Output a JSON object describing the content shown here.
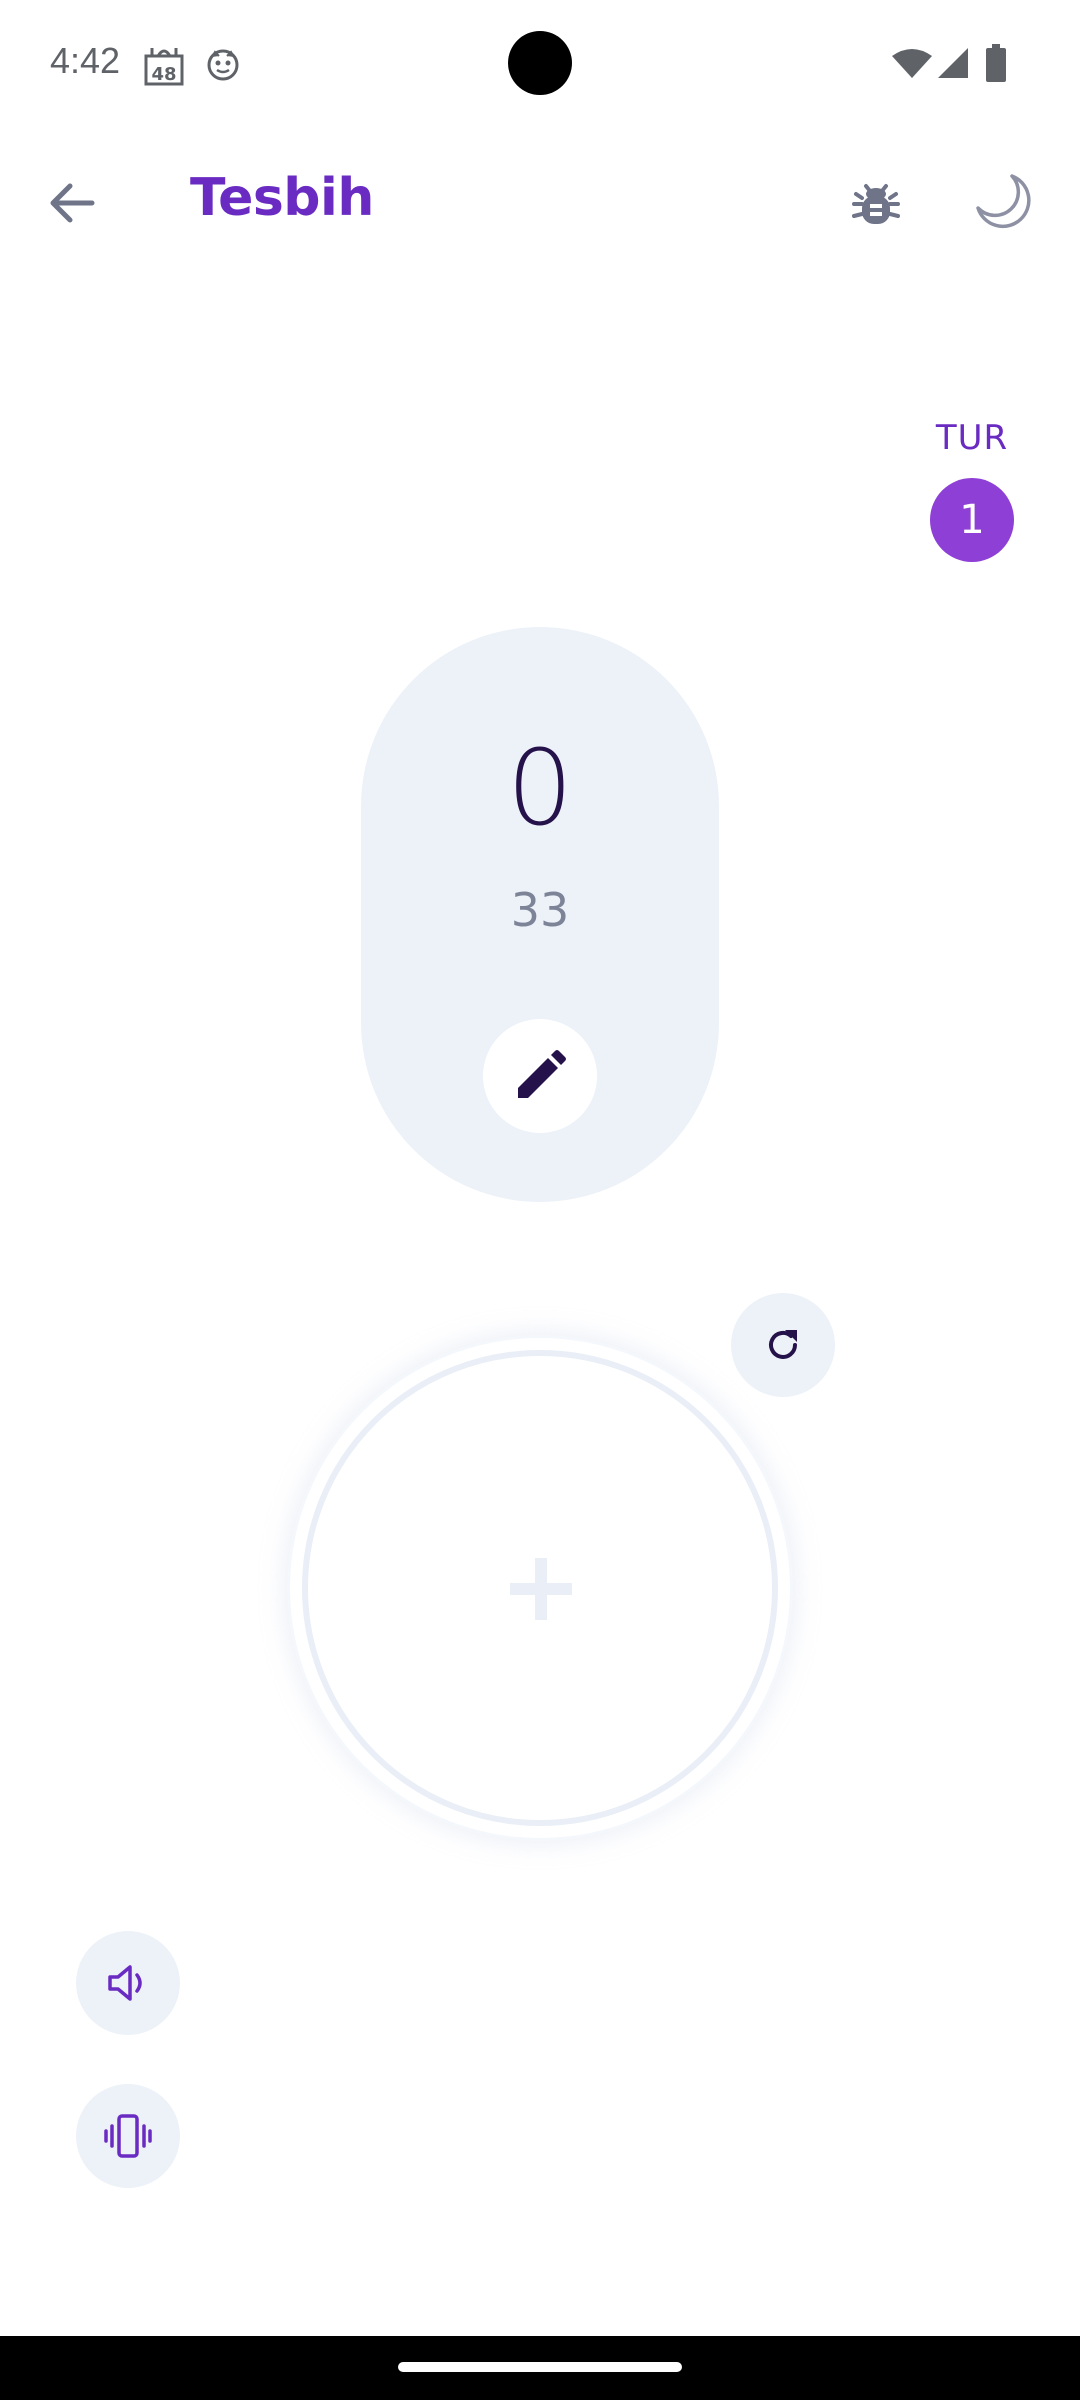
{
  "status_bar": {
    "time": "4:42",
    "icons_left": [
      "mosque-calendar-icon",
      "cat-face-icon"
    ],
    "icons_right": [
      "wifi-icon",
      "cellular-signal-icon",
      "battery-icon"
    ],
    "calendar_number": "48"
  },
  "app_bar": {
    "title": "Tesbih",
    "back_icon": "arrow-back-icon",
    "actions": [
      "bug-icon",
      "moon-icon"
    ]
  },
  "tour": {
    "label": "TUR",
    "value": "1"
  },
  "counter": {
    "current": "0",
    "target": "33",
    "edit_icon": "pencil-icon"
  },
  "controls": {
    "reset_icon": "refresh-icon",
    "tap_icon": "plus-icon",
    "sound_icon": "speaker-icon",
    "vibrate_icon": "vibrate-icon"
  },
  "colors": {
    "accent": "#6a2bc2",
    "badge": "#8e3fd6",
    "surface": "#edf2f9",
    "counter_text": "#25124a"
  }
}
